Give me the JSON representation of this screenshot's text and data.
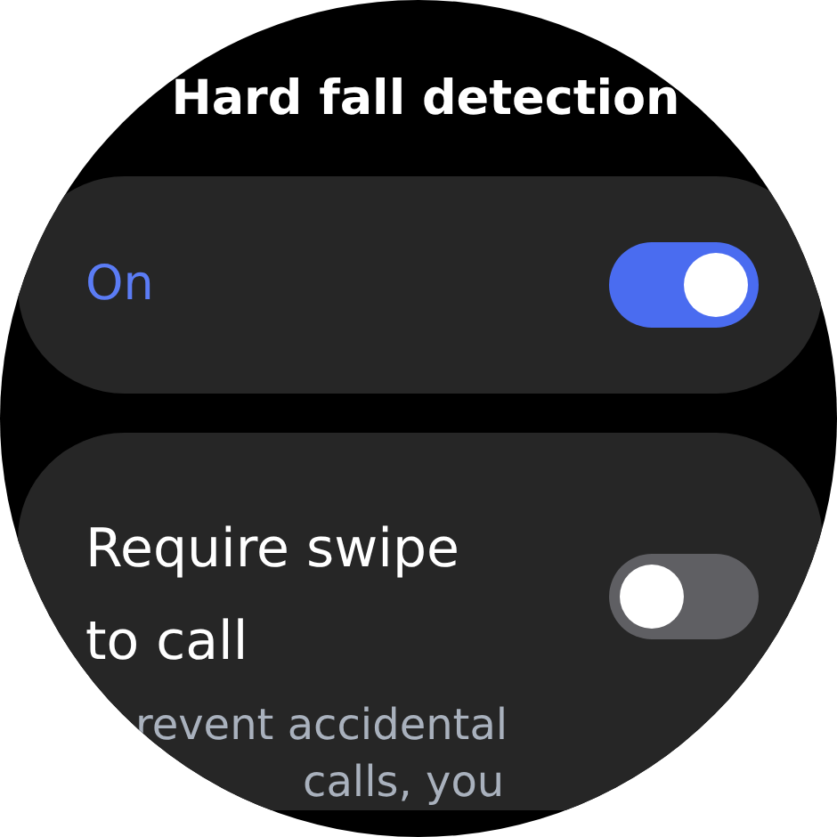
{
  "title": "Hard fall detection",
  "settings": [
    {
      "label": "On",
      "on": true
    },
    {
      "label": "Require swipe to call",
      "on": false,
      "description": [
        "revent accidental",
        "calls, you"
      ]
    }
  ]
}
